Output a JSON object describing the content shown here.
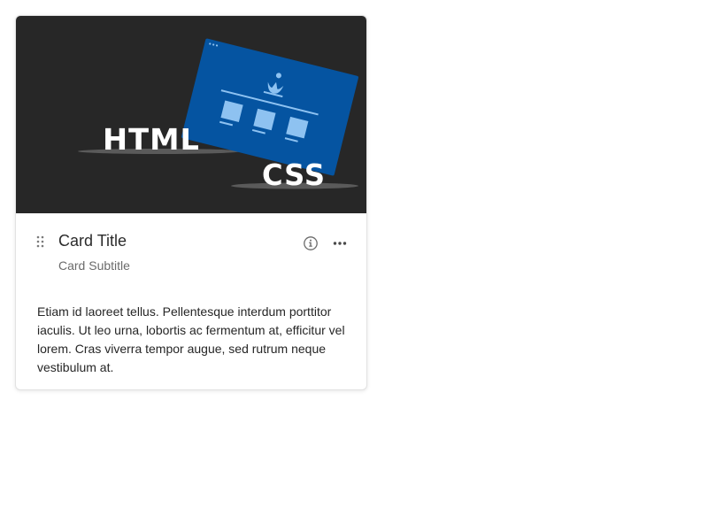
{
  "card": {
    "title": "Card Title",
    "subtitle": "Card Subtitle",
    "body": "Etiam id laoreet tellus. Pellentesque interdum porttitor iaculis. Ut leo urna, lobortis ac fermentum at, efficitur vel lorem. Cras viverra tempor augue, sed rutrum neque vestibulum at.",
    "media": {
      "word_html": "HTML",
      "word_css": "CSS",
      "background_color": "#272727",
      "browser_color": "#0554a1",
      "accent_color": "#8ec2f1"
    },
    "icons": {
      "drag": "drag-handle-icon",
      "info": "info-icon",
      "more": "more-horizontal-icon"
    }
  }
}
